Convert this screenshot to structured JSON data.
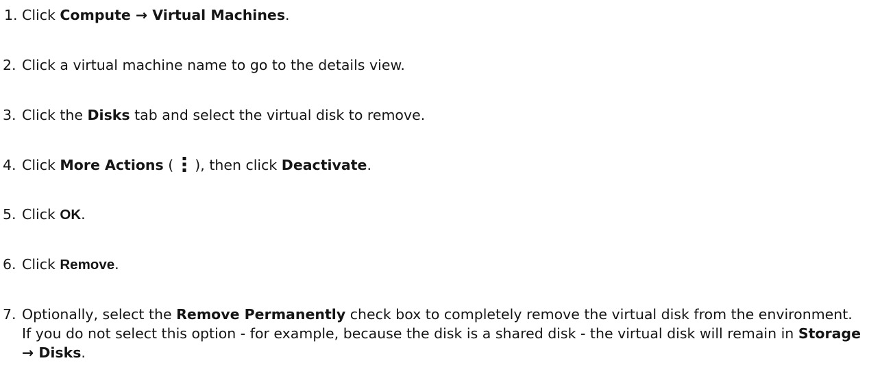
{
  "steps": [
    {
      "num": "1.",
      "pre": "Click ",
      "bold1": "Compute",
      "arrow": " → ",
      "bold2": "Virtual Machines",
      "post": "."
    },
    {
      "num": "2.",
      "text": "Click a virtual machine name to go to the details view."
    },
    {
      "num": "3.",
      "pre": "Click the ",
      "bold1": "Disks",
      "post": " tab and select the virtual disk to remove."
    },
    {
      "num": "4.",
      "pre": "Click ",
      "bold1": "More Actions",
      "open": " ( ",
      "icon": "kebab-vertical-icon",
      "close": " ), then click ",
      "bold2": "Deactivate",
      "post": "."
    },
    {
      "num": "5.",
      "pre": "Click ",
      "bold1": "OK",
      "post": "."
    },
    {
      "num": "6.",
      "pre": "Click ",
      "bold1": "Remove",
      "post": "."
    },
    {
      "num": "7.",
      "pre": "Optionally, select the ",
      "bold1": "Remove Permanently",
      "mid": " check box to completely remove the virtual disk from the environment. If you do not select this option - for example, because the disk is a shared disk - the virtual disk will remain in ",
      "bold2": "Storage",
      "arrow": " → ",
      "bold3": "Disks",
      "post": "."
    }
  ]
}
